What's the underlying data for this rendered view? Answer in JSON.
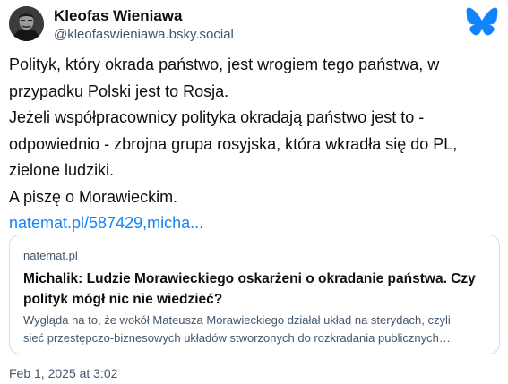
{
  "author": {
    "display_name": "Kleofas Wieniawa",
    "handle": "@kleofaswieniawa.bsky.social"
  },
  "platform_icon": "bluesky-butterfly-icon",
  "accent_color": "#1083fe",
  "post": {
    "lines": [
      "Polityk, który okrada państwo, jest wrogiem tego państwa, w",
      "przypadku Polski jest to Rosja.",
      "Jeżeli współpracownicy polityka okradają państwo jest to -",
      "odpowiednio - zbrojna grupa rosyjska, która wkradła się do PL,",
      "zielone ludziki.",
      "A piszę o Morawieckim."
    ],
    "link_text": "natemat.pl/587429,micha..."
  },
  "card": {
    "domain": "natemat.pl",
    "title_lines": [
      "Michalik: Ludzie Morawieckiego oskarżeni o okradanie państwa. Czy",
      "polityk mógł nic nie wiedzieć?"
    ],
    "description_lines": [
      "Wygląda na to, że wokół Mateusza Morawieckiego działał układ na sterydach, czyli",
      "sieć przestępczo-biznesowych układów stworzonych do rozkradania publicznych…"
    ]
  },
  "timestamp": "Feb 1, 2025 at 3:02"
}
